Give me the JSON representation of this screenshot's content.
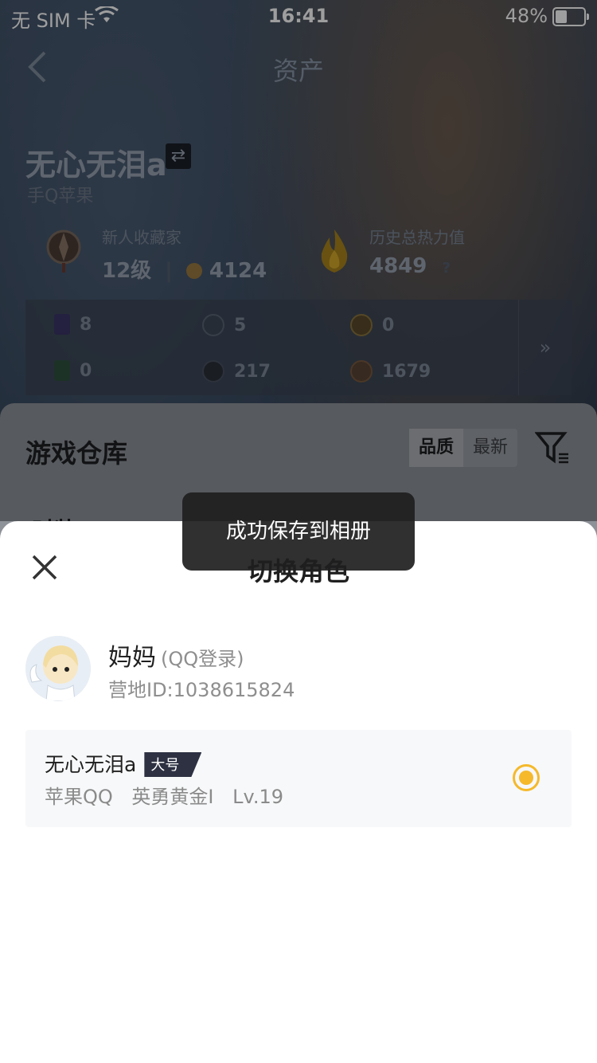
{
  "status_bar": {
    "carrier": "无 SIM 卡",
    "time": "16:41",
    "battery_pct": "48%",
    "battery_level": 0.48
  },
  "nav": {
    "title": "资产"
  },
  "profile": {
    "name": "无心无泪a",
    "platform": "手Q苹果",
    "online_text": "",
    "collector_label": "新人收藏家",
    "collector_level": "12级",
    "collector_points": "4124",
    "heat_label": "历史总热力值",
    "heat_value": "4849",
    "heat_help": "?"
  },
  "resources": [
    {
      "icon": "purple-card-icon",
      "value": "8"
    },
    {
      "icon": "silver-coin-icon",
      "value": "5"
    },
    {
      "icon": "gold-coin-icon",
      "value": "0"
    },
    {
      "icon": "green-card-icon",
      "value": "0"
    },
    {
      "icon": "dark-orb-icon",
      "value": "217"
    },
    {
      "icon": "bronze-medal-icon",
      "value": "1679"
    }
  ],
  "resources_more": "»",
  "warehouse": {
    "title": "游戏仓库",
    "sort_options": [
      "品质",
      "最新"
    ],
    "tab_first": "时装"
  },
  "sheet": {
    "title": "切换角色",
    "account_name": "妈妈",
    "account_login": "(QQ登录)",
    "account_id": "营地ID:1038615824",
    "role": {
      "name": "无心无泪a",
      "tag": "大号",
      "platform": "苹果QQ",
      "rank": "英勇黄金I",
      "level": "Lv.19"
    }
  },
  "toast": {
    "text": "成功保存到相册"
  },
  "colors": {
    "accent": "#f5b92b",
    "tag_bg": "#2d3142"
  }
}
